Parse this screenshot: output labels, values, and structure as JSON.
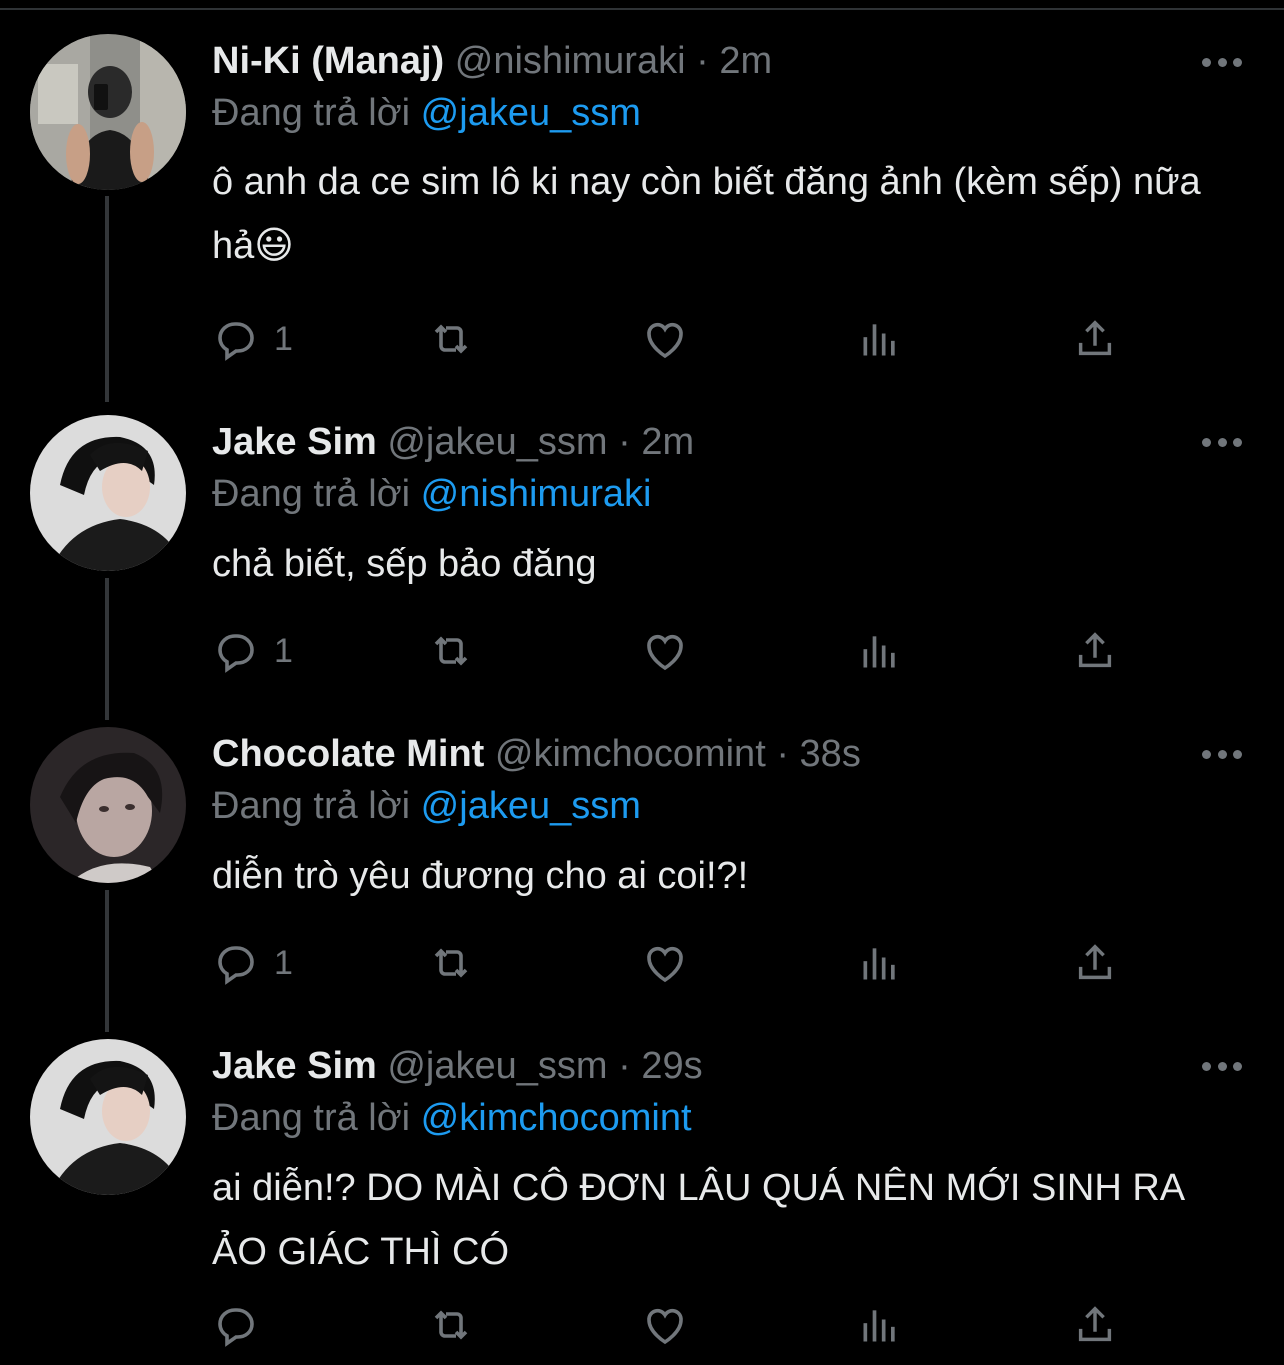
{
  "colors": {
    "background": "#000000",
    "text": "#e7e9ea",
    "muted": "#71767b",
    "accent": "#1d9bf0",
    "thread_line": "#333639"
  },
  "reply_prefix": "Đang trả lời",
  "tweets": [
    {
      "name": "Ni-Ki (Manaj)",
      "handle": "@nishimuraki",
      "separator": "·",
      "time": "2m",
      "reply_to": "@jakeu_ssm",
      "text": "ô anh da ce sim lô ki nay còn biết đăng ảnh (kèm sếp) nữa hả😃",
      "reply_count": "1",
      "avatar": "avatar-photo"
    },
    {
      "name": "Jake Sim",
      "handle": "@jakeu_ssm",
      "separator": "·",
      "time": "2m",
      "reply_to": "@nishimuraki",
      "text": "chả biết, sếp bảo đăng",
      "reply_count": "1",
      "avatar": "avatar-photo"
    },
    {
      "name": "Chocolate Mint",
      "handle": "@kimchocomint",
      "separator": "·",
      "time": "38s",
      "reply_to": "@jakeu_ssm",
      "text": "diễn trò yêu đương cho ai coi!?!",
      "reply_count": "1",
      "avatar": "avatar-photo"
    },
    {
      "name": "Jake Sim",
      "handle": "@jakeu_ssm",
      "separator": "·",
      "time": "29s",
      "reply_to": "@kimchocomint",
      "text": "ai diễn!? DO MÀI CÔ ĐƠN LÂU QUÁ NÊN MỚI SINH RA ẢO GIÁC THÌ CÓ",
      "reply_count": "",
      "avatar": "avatar-photo"
    }
  ],
  "icons": [
    "reply-icon",
    "retweet-icon",
    "like-icon",
    "views-icon",
    "share-icon",
    "more-icon"
  ]
}
